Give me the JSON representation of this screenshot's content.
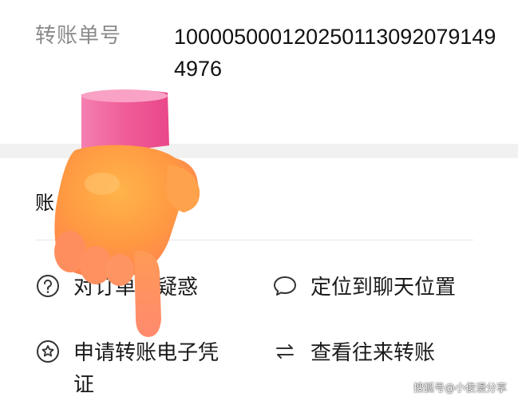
{
  "transfer": {
    "label": "转账单号",
    "number": "1000050001202501130920791494976"
  },
  "section": {
    "title_visible": "账"
  },
  "actions": [
    {
      "label": "对订单有疑惑",
      "icon": "question-circle-icon"
    },
    {
      "label": "定位到聊天位置",
      "icon": "chat-bubble-icon"
    },
    {
      "label": "申请转账电子凭证",
      "icon": "badge-star-icon"
    },
    {
      "label": "查看往来转账",
      "icon": "swap-arrows-icon"
    }
  ],
  "overlay": {
    "sticker": "pointing-hand-emoji"
  },
  "watermark": "搜狐号@小俊漫分享",
  "colors": {
    "label_gray": "#8a8a8a",
    "text": "#1b1b1b",
    "band_gray": "#f1f1f1",
    "hand_orange": "#ff9a4d",
    "cuff_pink": "#f0609a"
  }
}
